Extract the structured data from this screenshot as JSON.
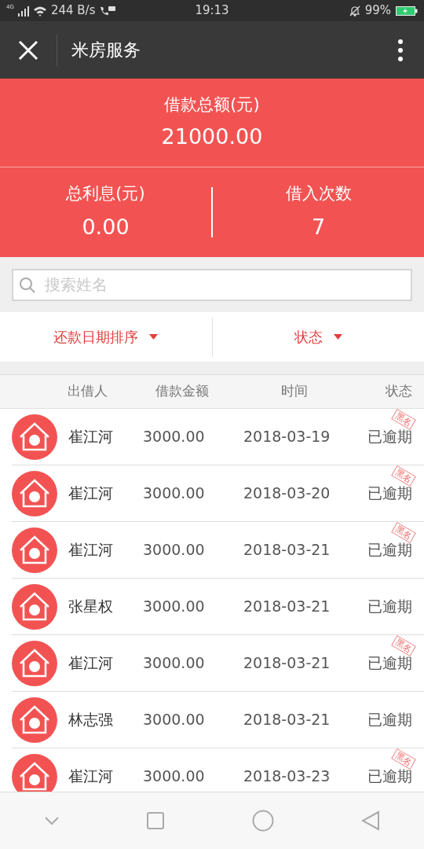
{
  "status_bar": {
    "network": "4G",
    "speed": "244 B/s",
    "time": "19:13",
    "battery": "99%"
  },
  "title_bar": {
    "title": "米房服务"
  },
  "summary": {
    "total_label": "借款总额(元)",
    "total_value": "21000.00",
    "interest_label": "总利息(元)",
    "interest_value": "0.00",
    "count_label": "借入次数",
    "count_value": "7"
  },
  "search": {
    "placeholder": "搜索姓名"
  },
  "filters": [
    "还款日期排序",
    "状态"
  ],
  "table": {
    "columns": [
      "出借人",
      "借款金额",
      "时间",
      "状态"
    ],
    "rows": [
      {
        "lender": "崔江河",
        "amount": "3000.00",
        "date": "2018-03-19",
        "status": "已逾期",
        "stamp": "黑名"
      },
      {
        "lender": "崔江河",
        "amount": "3000.00",
        "date": "2018-03-20",
        "status": "已逾期",
        "stamp": "黑名"
      },
      {
        "lender": "崔江河",
        "amount": "3000.00",
        "date": "2018-03-21",
        "status": "已逾期",
        "stamp": "黑名"
      },
      {
        "lender": "张星权",
        "amount": "3000.00",
        "date": "2018-03-21",
        "status": "已逾期"
      },
      {
        "lender": "崔江河",
        "amount": "3000.00",
        "date": "2018-03-21",
        "status": "已逾期",
        "stamp": "黑名"
      },
      {
        "lender": "林志强",
        "amount": "3000.00",
        "date": "2018-03-21",
        "status": "已逾期"
      },
      {
        "lender": "崔江河",
        "amount": "3000.00",
        "date": "2018-03-23",
        "status": "已逾期",
        "stamp": "黑名"
      }
    ]
  }
}
